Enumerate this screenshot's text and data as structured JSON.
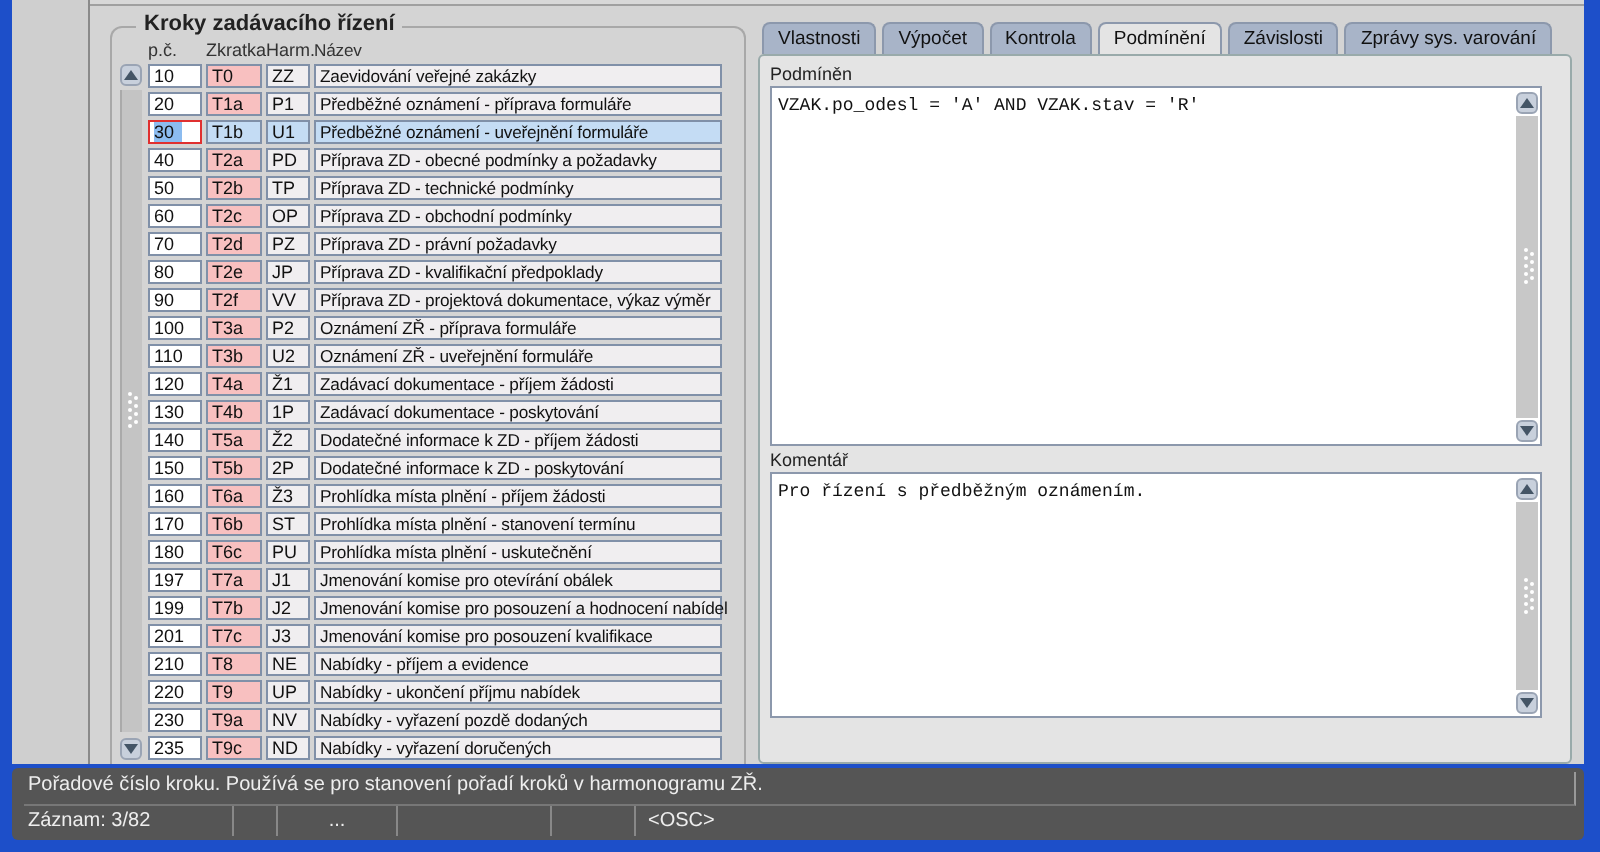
{
  "steps_group": {
    "title": "Kroky zadávacího řízení",
    "columns": [
      "p.č.",
      "Zkratka",
      "Harm.",
      "Název"
    ],
    "rows": [
      {
        "order": "10",
        "code": "T0",
        "harm": "ZZ",
        "name": "Zaevidování veřejné zakázky",
        "selected": false
      },
      {
        "order": "20",
        "code": "T1a",
        "harm": "P1",
        "name": "Předběžné oznámení - příprava formuláře",
        "selected": false
      },
      {
        "order": "30",
        "code": "T1b",
        "harm": "U1",
        "name": "Předběžné oznámení - uveřejnění formuláře",
        "selected": true
      },
      {
        "order": "40",
        "code": "T2a",
        "harm": "PD",
        "name": "Příprava ZD - obecné podmínky a požadavky",
        "selected": false
      },
      {
        "order": "50",
        "code": "T2b",
        "harm": "TP",
        "name": "Příprava ZD - technické podmínky",
        "selected": false
      },
      {
        "order": "60",
        "code": "T2c",
        "harm": "OP",
        "name": "Příprava ZD - obchodní podmínky",
        "selected": false
      },
      {
        "order": "70",
        "code": "T2d",
        "harm": "PZ",
        "name": "Příprava ZD - právní požadavky",
        "selected": false
      },
      {
        "order": "80",
        "code": "T2e",
        "harm": "JP",
        "name": "Příprava ZD - kvalifikační předpoklady",
        "selected": false
      },
      {
        "order": "90",
        "code": "T2f",
        "harm": "VV",
        "name": "Příprava ZD - projektová dokumentace, výkaz výměr",
        "selected": false
      },
      {
        "order": "100",
        "code": "T3a",
        "harm": "P2",
        "name": "Oznámení ZŘ - příprava formuláře",
        "selected": false
      },
      {
        "order": "110",
        "code": "T3b",
        "harm": "U2",
        "name": "Oznámení ZŘ - uveřejnění formuláře",
        "selected": false
      },
      {
        "order": "120",
        "code": "T4a",
        "harm": "Ž1",
        "name": "Zadávací dokumentace - příjem žádosti",
        "selected": false
      },
      {
        "order": "130",
        "code": "T4b",
        "harm": "1P",
        "name": "Zadávací dokumentace - poskytování",
        "selected": false
      },
      {
        "order": "140",
        "code": "T5a",
        "harm": "Ž2",
        "name": "Dodatečné informace k ZD - příjem žádosti",
        "selected": false
      },
      {
        "order": "150",
        "code": "T5b",
        "harm": "2P",
        "name": "Dodatečné informace k ZD - poskytování",
        "selected": false
      },
      {
        "order": "160",
        "code": "T6a",
        "harm": "Ž3",
        "name": "Prohlídka místa plnění - příjem žádosti",
        "selected": false
      },
      {
        "order": "170",
        "code": "T6b",
        "harm": "ST",
        "name": "Prohlídka místa plnění - stanovení termínu",
        "selected": false
      },
      {
        "order": "180",
        "code": "T6c",
        "harm": "PU",
        "name": "Prohlídka místa plnění - uskutečnění",
        "selected": false
      },
      {
        "order": "197",
        "code": "T7a",
        "harm": "J1",
        "name": "Jmenování komise pro otevírání obálek",
        "selected": false
      },
      {
        "order": "199",
        "code": "T7b",
        "harm": "J2",
        "name": "Jmenování komise pro posouzení a hodnocení nabídel",
        "selected": false
      },
      {
        "order": "201",
        "code": "T7c",
        "harm": "J3",
        "name": "Jmenování komise pro posouzení kvalifikace",
        "selected": false
      },
      {
        "order": "210",
        "code": "T8",
        "harm": "NE",
        "name": "Nabídky - příjem a evidence",
        "selected": false
      },
      {
        "order": "220",
        "code": "T9",
        "harm": "UP",
        "name": "Nabídky - ukončení příjmu nabídek",
        "selected": false
      },
      {
        "order": "230",
        "code": "T9a",
        "harm": "NV",
        "name": "Nabídky - vyřazení pozdě dodaných",
        "selected": false
      },
      {
        "order": "235",
        "code": "T9c",
        "harm": "ND",
        "name": "Nabídky - vyřazení doručených",
        "selected": false
      }
    ]
  },
  "tabs": [
    {
      "label": "Vlastnosti",
      "selected": false
    },
    {
      "label": "Výpočet",
      "selected": false
    },
    {
      "label": "Kontrola",
      "selected": false
    },
    {
      "label": "Podmínění",
      "selected": true
    },
    {
      "label": "Závislosti",
      "selected": false
    },
    {
      "label": "Zprávy sys. varování",
      "selected": false
    }
  ],
  "condition": {
    "label": "Podmíněn",
    "value": "VZAK.po_odesl = 'A' AND VZAK.stav = 'R'"
  },
  "comment": {
    "label": "Komentář",
    "value": "Pro řízení s předběžným oznámením."
  },
  "status_bar": {
    "message": "Pořadové číslo kroku. Používá se pro stanovení pořadí kroků v harmonogramu ZŘ.",
    "record": "Záznam: 3/82",
    "indicator": "...",
    "mode": "<OSC>"
  }
}
